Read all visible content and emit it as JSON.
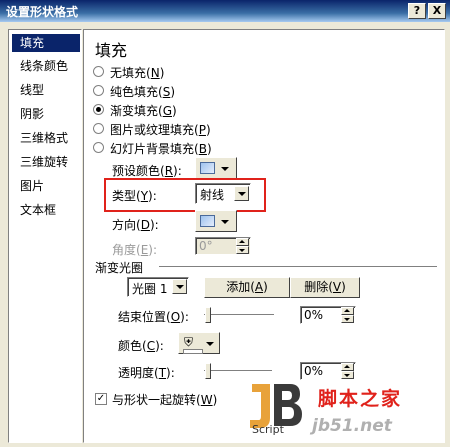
{
  "window": {
    "title": "设置形状格式",
    "help_button": "?",
    "close_button": "X"
  },
  "sidebar": {
    "items": [
      {
        "label": "填充",
        "selected": true
      },
      {
        "label": "线条颜色"
      },
      {
        "label": "线型"
      },
      {
        "label": "阴影"
      },
      {
        "label": "三维格式"
      },
      {
        "label": "三维旋转"
      },
      {
        "label": "图片"
      },
      {
        "label": "文本框"
      }
    ]
  },
  "fill": {
    "heading": "填充",
    "options": [
      {
        "label": "无填充",
        "key": "N",
        "checked": false
      },
      {
        "label": "纯色填充",
        "key": "S",
        "checked": false
      },
      {
        "label": "渐变填充",
        "key": "G",
        "checked": true
      },
      {
        "label": "图片或纹理填充",
        "key": "P",
        "checked": false
      },
      {
        "label": "幻灯片背景填充",
        "key": "B",
        "checked": false
      }
    ],
    "preset_label": "预设颜色",
    "preset_key": "R",
    "type_label": "类型",
    "type_key": "Y",
    "type_value": "射线",
    "direction_label": "方向",
    "direction_key": "D",
    "angle_label": "角度",
    "angle_key": "E",
    "angle_value": "0°",
    "stops_heading": "渐变光圈",
    "stop_select": "光圈 1",
    "add_button": "添加",
    "add_key": "A",
    "remove_button": "删除",
    "remove_key": "V",
    "end_position_label": "结束位置",
    "end_position_key": "O",
    "end_position_value": "0%",
    "color_label": "颜色",
    "color_key": "C",
    "transparency_label": "透明度",
    "transparency_key": "T",
    "transparency_value": "0%",
    "rotate_label": "与形状一起旋转",
    "rotate_key": "W",
    "rotate_checked": true
  },
  "watermark": {
    "logo_letters": "JB",
    "logo_text": "Script",
    "cn": "脚本之家",
    "url": "jb51.net"
  },
  "colors": {
    "titlebar": "#0a246a",
    "selection": "#0a246a",
    "highlight": "#e0221b",
    "window_bg": "#ece9d8"
  }
}
